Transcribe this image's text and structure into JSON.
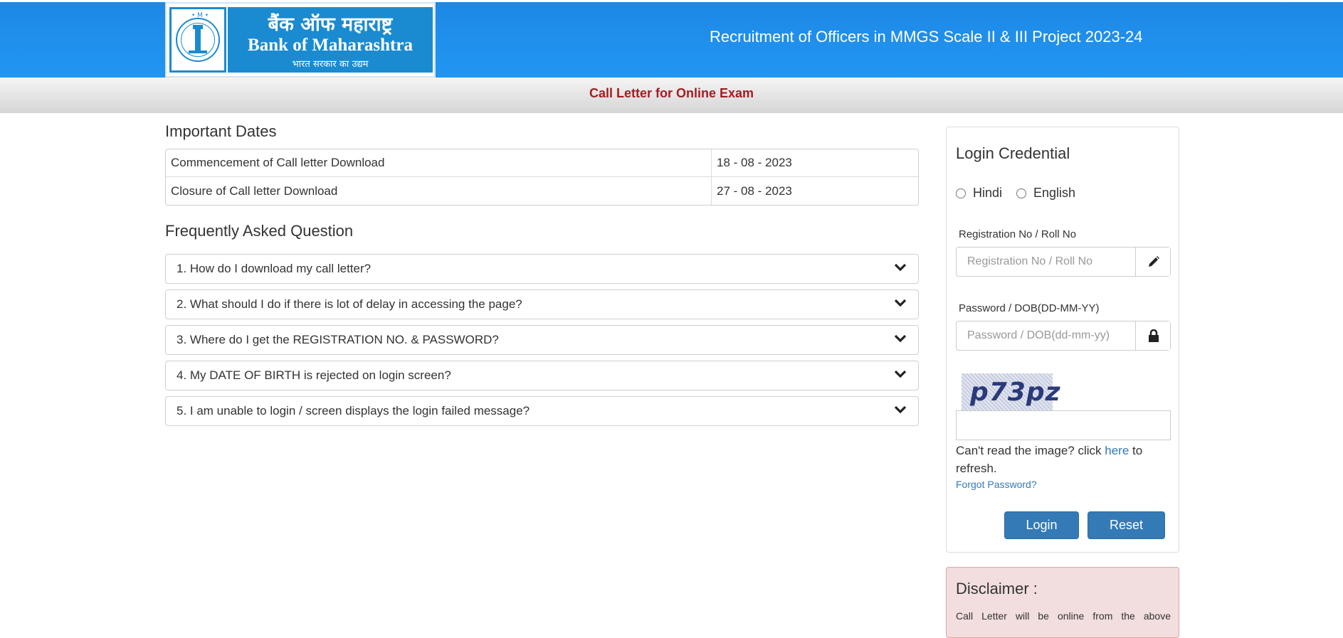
{
  "header": {
    "logo_hindi": "बैंक ऑफ महाराष्ट्र",
    "logo_english": "Bank of Maharashtra",
    "logo_tagline": "भारत सरकार का उद्यम",
    "title": "Recruitment of Officers in MMGS Scale II & III Project 2023-24"
  },
  "subheader": {
    "text": "Call Letter for Online Exam"
  },
  "important_dates": {
    "heading": "Important Dates",
    "rows": [
      {
        "label": "Commencement of Call letter Download",
        "value": "18 - 08 - 2023"
      },
      {
        "label": "Closure of Call letter Download",
        "value": "27 - 08 - 2023"
      }
    ]
  },
  "faq": {
    "heading": "Frequently Asked Question",
    "items": [
      "1. How do I download my call letter?",
      "2. What should I do if there is lot of delay in accessing the page?",
      "3. Where do I get the REGISTRATION NO. & PASSWORD?",
      "4. My DATE OF BIRTH is rejected on login screen?",
      "5. I am unable to login / screen displays the login failed message?"
    ]
  },
  "login": {
    "title": "Login Credential",
    "languages": [
      "Hindi",
      "English"
    ],
    "reg_label": "Registration No / Roll No",
    "reg_placeholder": "Registration No / Roll No",
    "pwd_label": "Password / DOB(DD-MM-YY)",
    "pwd_placeholder": "Password / DOB(dd-mm-yy)",
    "captcha_text": "p73pz",
    "refresh_prefix": "Can't read the image? click ",
    "refresh_link": "here",
    "refresh_suffix": " to refresh.",
    "forgot": "Forgot Password?",
    "login_label": "Login",
    "reset_label": "Reset"
  },
  "disclaimer": {
    "title": "Disclaimer :",
    "text": "Call Letter will be online from the above"
  },
  "icons": {
    "reg_addon": "pencil-icon",
    "pwd_addon": "lock-icon",
    "faq_toggle": "chevron-down-icon"
  },
  "colors": {
    "header_blue": "#1e88e5",
    "subheader_red": "#a31d22",
    "button_blue": "#337ab7",
    "disclaimer_bg": "#f2dede"
  }
}
